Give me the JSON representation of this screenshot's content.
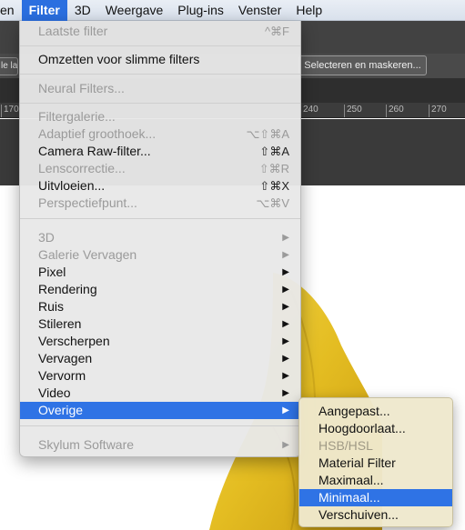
{
  "menubar": {
    "items": [
      "en",
      "Filter",
      "3D",
      "Weergave",
      "Plug-ins",
      "Venster",
      "Help"
    ]
  },
  "toolbar": {
    "left_button": "le lag",
    "select_mask_button": "Selecteren en maskeren..."
  },
  "ruler": {
    "ticks_left": [
      "170"
    ],
    "ticks_right": [
      "240",
      "250",
      "260",
      "270"
    ]
  },
  "filter_menu": {
    "last_filter": {
      "label": "Laatste filter",
      "shortcut": "^⌘F"
    },
    "smart_filters": "Omzetten voor slimme filters",
    "neural_filters": "Neural Filters...",
    "filter_gallery": "Filtergalerie...",
    "adaptive_wide": {
      "label": "Adaptief groothoek...",
      "shortcut": "⌥⇧⌘A"
    },
    "camera_raw": {
      "label": "Camera Raw-filter...",
      "shortcut": "⇧⌘A"
    },
    "lens_correction": {
      "label": "Lenscorrectie...",
      "shortcut": "⇧⌘R"
    },
    "liquify": {
      "label": "Uitvloeien...",
      "shortcut": "⇧⌘X"
    },
    "vanishing_point": {
      "label": "Perspectiefpunt...",
      "shortcut": "⌥⌘V"
    },
    "submenus": [
      "3D",
      "Galerie Vervagen",
      "Pixel",
      "Rendering",
      "Ruis",
      "Stileren",
      "Verscherpen",
      "Vervagen",
      "Vervorm",
      "Video",
      "Overige"
    ],
    "skylum": "Skylum Software"
  },
  "other_submenu": {
    "items": [
      "Aangepast...",
      "Hoogdoorlaat...",
      "HSB/HSL",
      "Material Filter",
      "Maximaal...",
      "Minimaal...",
      "Verschuiven..."
    ]
  },
  "colors": {
    "accent": "#2f73e5",
    "menubar_active": "#2b6fe0",
    "leaf_yellow": "#e8c42a"
  }
}
